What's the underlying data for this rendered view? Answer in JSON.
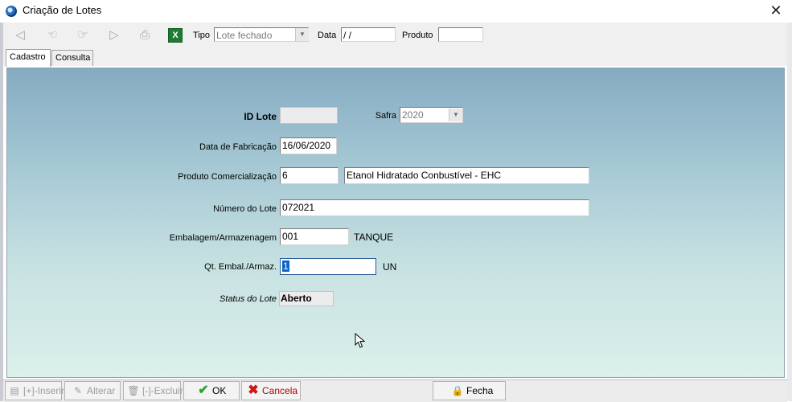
{
  "window": {
    "title": "Criação de Lotes",
    "close_glyph": "✕"
  },
  "toolbar": {
    "buttons": [
      {
        "icon": "arrow-back-icon",
        "glyph": "◁"
      },
      {
        "icon": "hand-point-left-icon",
        "glyph": "☜"
      },
      {
        "icon": "hand-point-right-icon",
        "glyph": "☞"
      },
      {
        "icon": "arrow-forward-icon",
        "glyph": "▷"
      },
      {
        "icon": "printer-icon",
        "glyph": "⎙"
      }
    ],
    "excel_glyph": "X",
    "tipo_label": "Tipo",
    "tipo_value": "Lote fechado",
    "data_label": "Data",
    "data_value": " /  /",
    "produto_label": "Produto",
    "produto_value": ""
  },
  "tabs": [
    {
      "label": "Cadastro",
      "active": true
    },
    {
      "label": "Consulta",
      "active": false
    }
  ],
  "form": {
    "id_lote_label": "ID Lote",
    "id_lote_value": "",
    "safra_label": "Safra",
    "safra_value": "2020",
    "data_fab_label": "Data de Fabricação",
    "data_fab_value": "16/06/2020",
    "produto_label": "Produto Comercialização",
    "produto_code": "6",
    "produto_desc": "Etanol Hidratado Conbustível - EHC",
    "numero_label": "Número do Lote",
    "numero_value": "072021",
    "embalagem_label": "Embalagem/Armazenagem",
    "embalagem_code": "001",
    "embalagem_desc": "TANQUE",
    "qt_label": "Qt. Embal./Armaz.",
    "qt_value": "1",
    "qt_unit": "UN",
    "status_label": "Status do Lote",
    "status_value": "Aberto"
  },
  "bottom": {
    "inserir": "[+]-Inserir",
    "alterar": "Alterar",
    "excluir": "[-]-Excluir",
    "ok": "OK",
    "cancela": "Cancela",
    "fecha": "Fecha"
  },
  "colors": {
    "ok_green": "#2e9e2e",
    "cancel_red": "#c81818",
    "cancel_text": "#b00000",
    "panel_top": "#85abc2",
    "panel_bottom": "#dbf0ea"
  }
}
